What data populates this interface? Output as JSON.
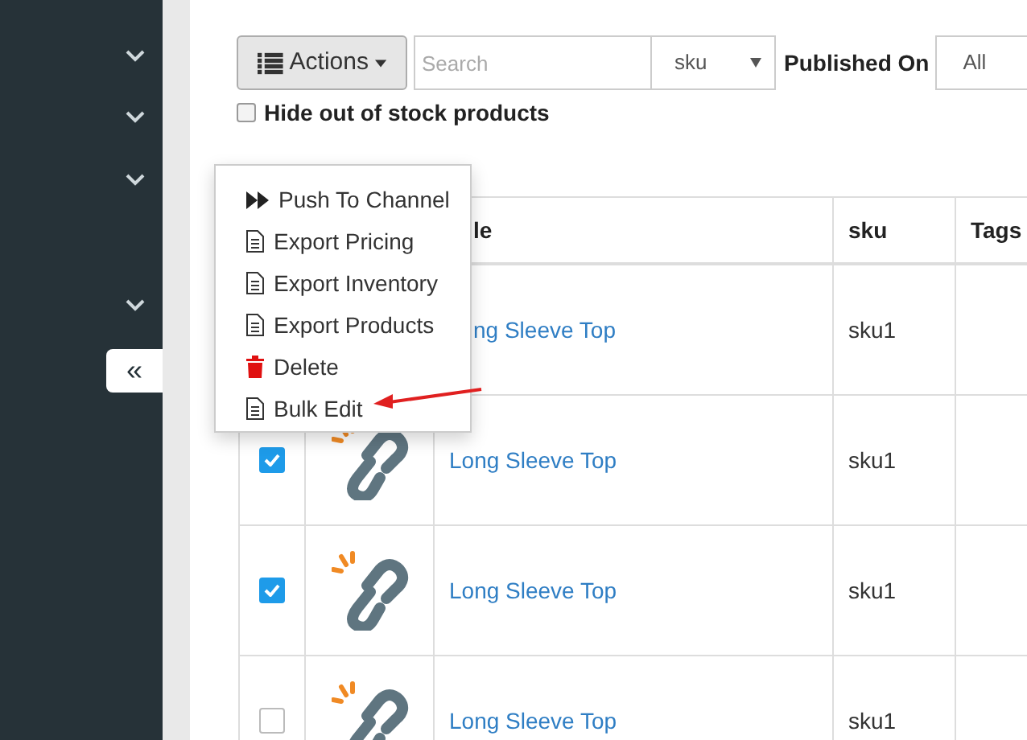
{
  "sidebar": {
    "collapse_button": "«"
  },
  "toolbar": {
    "actions_button": "Actions",
    "search": {
      "placeholder": "Search"
    },
    "search_field": "sku",
    "published_on_label": "Published On",
    "published_on": "All"
  },
  "hide_out_of_stock": {
    "label": "Hide out of stock products",
    "checked": false
  },
  "actions_menu": [
    {
      "label": "Push To Channel",
      "kind": "push"
    },
    {
      "label": "Export Pricing",
      "kind": "document"
    },
    {
      "label": "Export Inventory",
      "kind": "document"
    },
    {
      "label": "Export Products",
      "kind": "document"
    },
    {
      "label": "Delete",
      "kind": "delete"
    },
    {
      "label": "Bulk Edit",
      "kind": "document"
    }
  ],
  "table": {
    "columns": [
      "le",
      "sku",
      "Tags"
    ],
    "rows": [
      {
        "title": "ng Sleeve Top",
        "sku": "sku1"
      },
      {
        "title": "Long Sleeve Top",
        "sku": "sku1",
        "checked": true
      },
      {
        "title": "Long Sleeve Top",
        "sku": "sku1",
        "checked": true
      },
      {
        "title": "Long Sleeve Top",
        "sku": "sku1",
        "checked": false
      }
    ]
  }
}
